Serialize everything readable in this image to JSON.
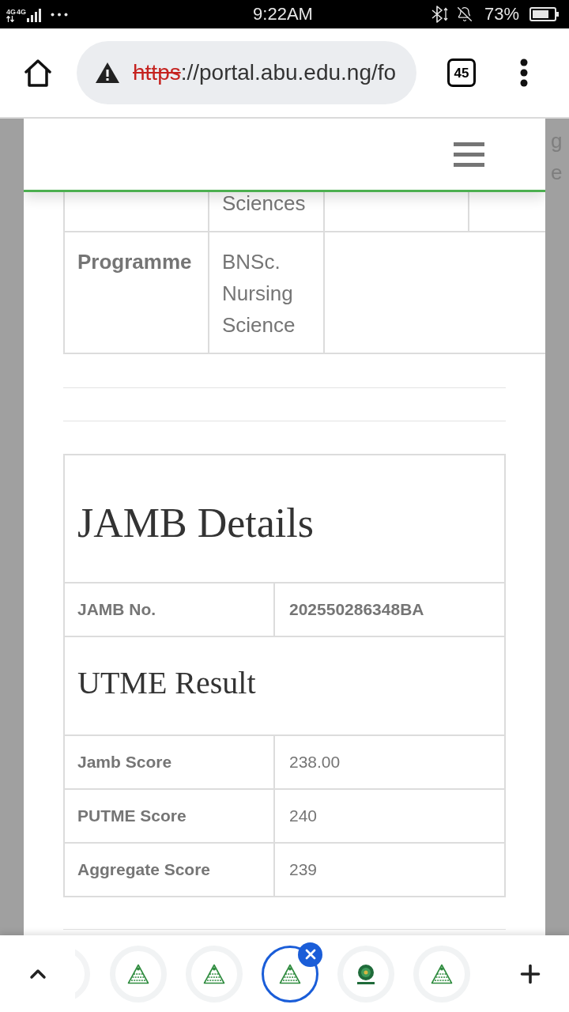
{
  "status_bar": {
    "network_labels": [
      "4G",
      "4G"
    ],
    "time": "9:22AM",
    "battery_percent": "73%"
  },
  "browser_toolbar": {
    "url": {
      "scheme": "https",
      "rest": "://portal.abu.edu.ng/fo",
      "secure": false
    },
    "tab_count": "45"
  },
  "page": {
    "side_text": [
      "g",
      "e"
    ],
    "programme_table": {
      "rows": [
        {
          "kind": "continued",
          "value": "Sciences"
        },
        {
          "kind": "field",
          "label": "Programme",
          "value": "BNSc. Nursing Science"
        }
      ]
    },
    "jamb": {
      "title": "JAMB Details",
      "rows": [
        {
          "label": "JAMB No.",
          "value": "202550286348BA",
          "emphasis": true
        }
      ],
      "subtitle": "UTME Result",
      "result_rows": [
        {
          "label": "Jamb Score",
          "value": "238.00",
          "emphasis": false
        },
        {
          "label": "PUTME Score",
          "value": "240",
          "emphasis": false
        },
        {
          "label": "Aggregate Score",
          "value": "239",
          "emphasis": false
        }
      ]
    }
  },
  "tab_strip": {
    "tabs": [
      {
        "kind": "edge",
        "selected": false
      },
      {
        "kind": "triangle",
        "selected": false
      },
      {
        "kind": "triangle",
        "selected": false
      },
      {
        "kind": "triangle",
        "selected": true
      },
      {
        "kind": "round",
        "selected": false
      },
      {
        "kind": "triangle",
        "selected": false
      }
    ]
  }
}
